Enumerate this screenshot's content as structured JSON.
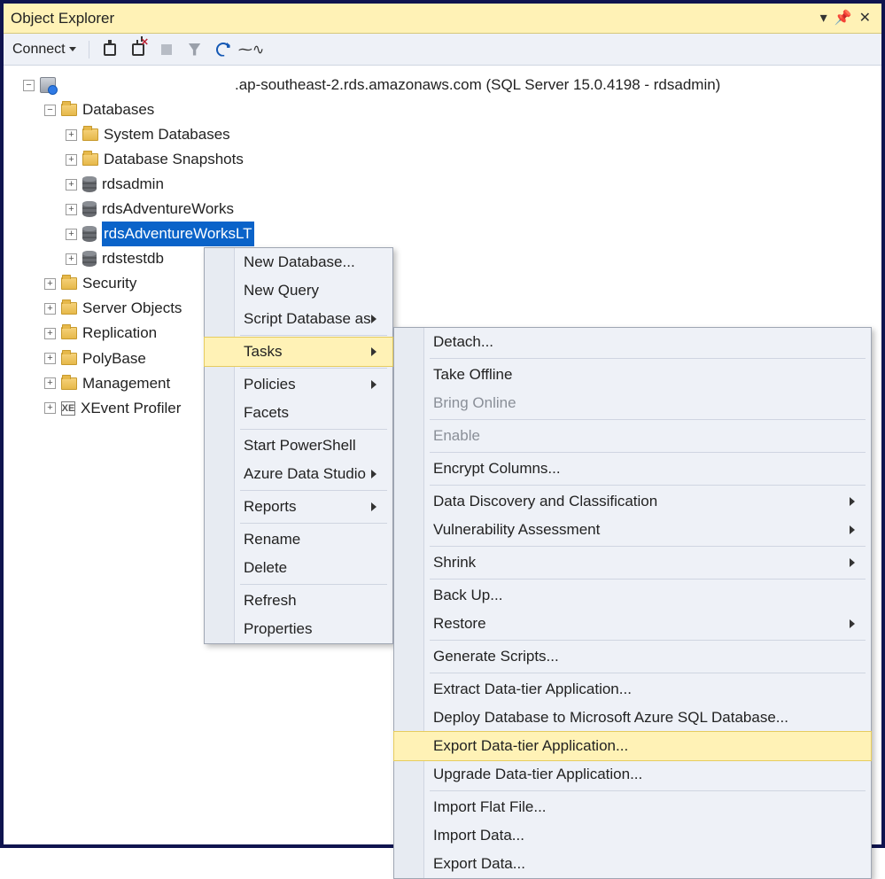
{
  "panel_title": "Object Explorer",
  "toolbar": {
    "connect_label": "Connect"
  },
  "server_label": ".ap-southeast-2.rds.amazonaws.com (SQL Server 15.0.4198 - rdsadmin)",
  "tree": {
    "databases": "Databases",
    "system_databases": "System Databases",
    "database_snapshots": "Database Snapshots",
    "rdsadmin": "rdsadmin",
    "rdsAdventureWorks": "rdsAdventureWorks",
    "rdsAdventureWorksLT": "rdsAdventureWorksLT",
    "rdstestdb": "rdstestdb",
    "security": "Security",
    "server_objects": "Server Objects",
    "replication": "Replication",
    "polybase": "PolyBase",
    "management": "Management",
    "xevent_profiler": "XEvent Profiler"
  },
  "menu1": {
    "new_database": "New Database...",
    "new_query": "New Query",
    "script_db_as": "Script Database as",
    "tasks": "Tasks",
    "policies": "Policies",
    "facets": "Facets",
    "start_powershell": "Start PowerShell",
    "azure_data_studio": "Azure Data Studio",
    "reports": "Reports",
    "rename": "Rename",
    "delete": "Delete",
    "refresh": "Refresh",
    "properties": "Properties"
  },
  "menu2": {
    "detach": "Detach...",
    "take_offline": "Take Offline",
    "bring_online": "Bring Online",
    "enable": "Enable",
    "encrypt_columns": "Encrypt Columns...",
    "data_discovery": "Data Discovery and Classification",
    "vuln_assessment": "Vulnerability Assessment",
    "shrink": "Shrink",
    "back_up": "Back Up...",
    "restore": "Restore",
    "generate_scripts": "Generate Scripts...",
    "extract_dta": "Extract Data-tier Application...",
    "deploy_azure": "Deploy Database to Microsoft Azure SQL Database...",
    "export_dta": "Export Data-tier Application...",
    "upgrade_dta": "Upgrade Data-tier Application...",
    "import_flat_file": "Import Flat File...",
    "import_data": "Import Data...",
    "export_data": "Export Data..."
  }
}
